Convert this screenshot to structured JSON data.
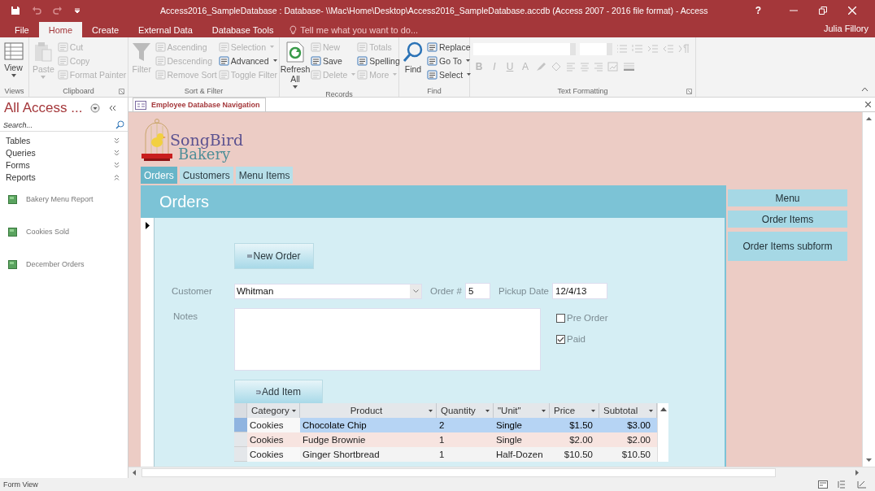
{
  "window": {
    "title": "Access2016_SampleDatabase : Database- \\\\Mac\\Home\\Desktop\\Access2016_SampleDatabase.accdb (Access 2007 - 2016 file format) - Access",
    "help": "?"
  },
  "ribbon_tabs": [
    {
      "label": "File",
      "selected": false
    },
    {
      "label": "Home",
      "selected": true
    },
    {
      "label": "Create",
      "selected": false
    },
    {
      "label": "External Data",
      "selected": false
    },
    {
      "label": "Database Tools",
      "selected": false
    }
  ],
  "tell_me": {
    "placeholder": "Tell me what you want to do..."
  },
  "user": "Julia Fillory",
  "ribbon_groups": [
    {
      "label": "Views",
      "launcher": false,
      "items": [
        {
          "label": "View",
          "kind": "large",
          "disabled": false,
          "dropdown": true
        }
      ]
    },
    {
      "label": "Clipboard",
      "launcher": true,
      "items": [
        {
          "label": "Paste",
          "kind": "large",
          "disabled": true,
          "dropdown": true
        },
        {
          "label": "Cut",
          "kind": "small",
          "disabled": true,
          "dropdown": false
        },
        {
          "label": "Copy",
          "kind": "small",
          "disabled": true,
          "dropdown": false
        },
        {
          "label": "Format Painter",
          "kind": "small",
          "disabled": true,
          "dropdown": false
        }
      ]
    },
    {
      "label": "Sort & Filter",
      "launcher": false,
      "items": [
        {
          "label": "Filter",
          "kind": "large",
          "disabled": true,
          "dropdown": false
        },
        {
          "label": "Ascending",
          "kind": "small",
          "disabled": true,
          "dropdown": false
        },
        {
          "label": "Descending",
          "kind": "small",
          "disabled": true,
          "dropdown": false
        },
        {
          "label": "Remove Sort",
          "kind": "small",
          "disabled": true,
          "dropdown": false
        },
        {
          "label": "Selection",
          "kind": "small",
          "disabled": true,
          "dropdown": true
        },
        {
          "label": "Advanced",
          "kind": "small",
          "disabled": false,
          "dropdown": true
        },
        {
          "label": "Toggle Filter",
          "kind": "small",
          "disabled": true,
          "dropdown": false
        }
      ]
    },
    {
      "label": "Records",
      "launcher": false,
      "items": [
        {
          "label": "Refresh All",
          "kind": "large",
          "disabled": false,
          "dropdown": true
        },
        {
          "label": "New",
          "kind": "small",
          "disabled": true,
          "dropdown": false
        },
        {
          "label": "Save",
          "kind": "small",
          "disabled": false,
          "dropdown": false
        },
        {
          "label": "Delete",
          "kind": "small",
          "disabled": true,
          "dropdown": true
        },
        {
          "label": "Totals",
          "kind": "small",
          "disabled": true,
          "dropdown": false
        },
        {
          "label": "Spelling",
          "kind": "small",
          "disabled": false,
          "dropdown": false
        },
        {
          "label": "More",
          "kind": "small",
          "disabled": true,
          "dropdown": true
        }
      ]
    },
    {
      "label": "Find",
      "launcher": false,
      "items": [
        {
          "label": "Find",
          "kind": "large",
          "disabled": false,
          "dropdown": false
        },
        {
          "label": "Replace",
          "kind": "small",
          "disabled": false,
          "dropdown": false
        },
        {
          "label": "Go To",
          "kind": "small",
          "disabled": false,
          "dropdown": true
        },
        {
          "label": "Select",
          "kind": "small",
          "disabled": false,
          "dropdown": true
        }
      ]
    }
  ],
  "text_formatting": {
    "label": "Text Formatting",
    "buttons": [
      {
        "label": "B",
        "disabled": true
      },
      {
        "label": "I",
        "disabled": true
      },
      {
        "label": "U",
        "disabled": true
      },
      {
        "label": "A",
        "disabled": true
      }
    ]
  },
  "nav_pane": {
    "title": "All Access ...",
    "search": {
      "placeholder": "Search..."
    },
    "groups": [
      {
        "label": "Tables",
        "expanded": false
      },
      {
        "label": "Queries",
        "expanded": false
      },
      {
        "label": "Forms",
        "expanded": false
      },
      {
        "label": "Reports",
        "expanded": true,
        "children": [
          {
            "label": "Bakery Menu Report"
          },
          {
            "label": "Cookies Sold"
          },
          {
            "label": "December Orders"
          }
        ]
      }
    ]
  },
  "document_tab": {
    "label": "Employee Database Navigation"
  },
  "form": {
    "logo": {
      "line_1": "SongBird",
      "line_2": "Bakery"
    },
    "nav_tabs": [
      {
        "label": "Orders",
        "selected": true
      },
      {
        "label": "Customers",
        "selected": false
      },
      {
        "label": "Menu Items",
        "selected": false
      }
    ],
    "subform": {
      "title": "Orders",
      "new_order": "New Order",
      "customer": {
        "label": "Customer",
        "value": "Whitman"
      },
      "order_number": {
        "label": "Order #",
        "value": "5"
      },
      "pickup_date": {
        "label": "Pickup Date",
        "value": "12/4/13"
      },
      "notes": {
        "label": "Notes"
      },
      "checkboxes": [
        {
          "label": "Pre Order",
          "checked": false
        },
        {
          "label": "Paid",
          "checked": true
        }
      ],
      "add_item": "Add Item",
      "datasheet": {
        "columns": [
          "Category",
          "Product",
          "Quantity",
          "\"Unit\"",
          "Price",
          "Subtotal"
        ],
        "rows": [
          {
            "selected": true,
            "cells": [
              "Cookies",
              "Chocolate Chip",
              "2",
              "Single",
              "$1.50",
              "$3.00"
            ]
          },
          {
            "selected": false,
            "cells": [
              "Cookies",
              "Fudge Brownie",
              "1",
              "Single",
              "$2.00",
              "$2.00"
            ]
          },
          {
            "selected": false,
            "cells": [
              "Cookies",
              "Ginger Shortbread",
              "1",
              "Half-Dozen",
              "$10.50",
              "$10.50"
            ]
          }
        ]
      }
    },
    "side_buttons": [
      "Menu",
      "Order Items",
      "Order Items subform"
    ]
  },
  "status_bar": {
    "text": "Form View"
  }
}
